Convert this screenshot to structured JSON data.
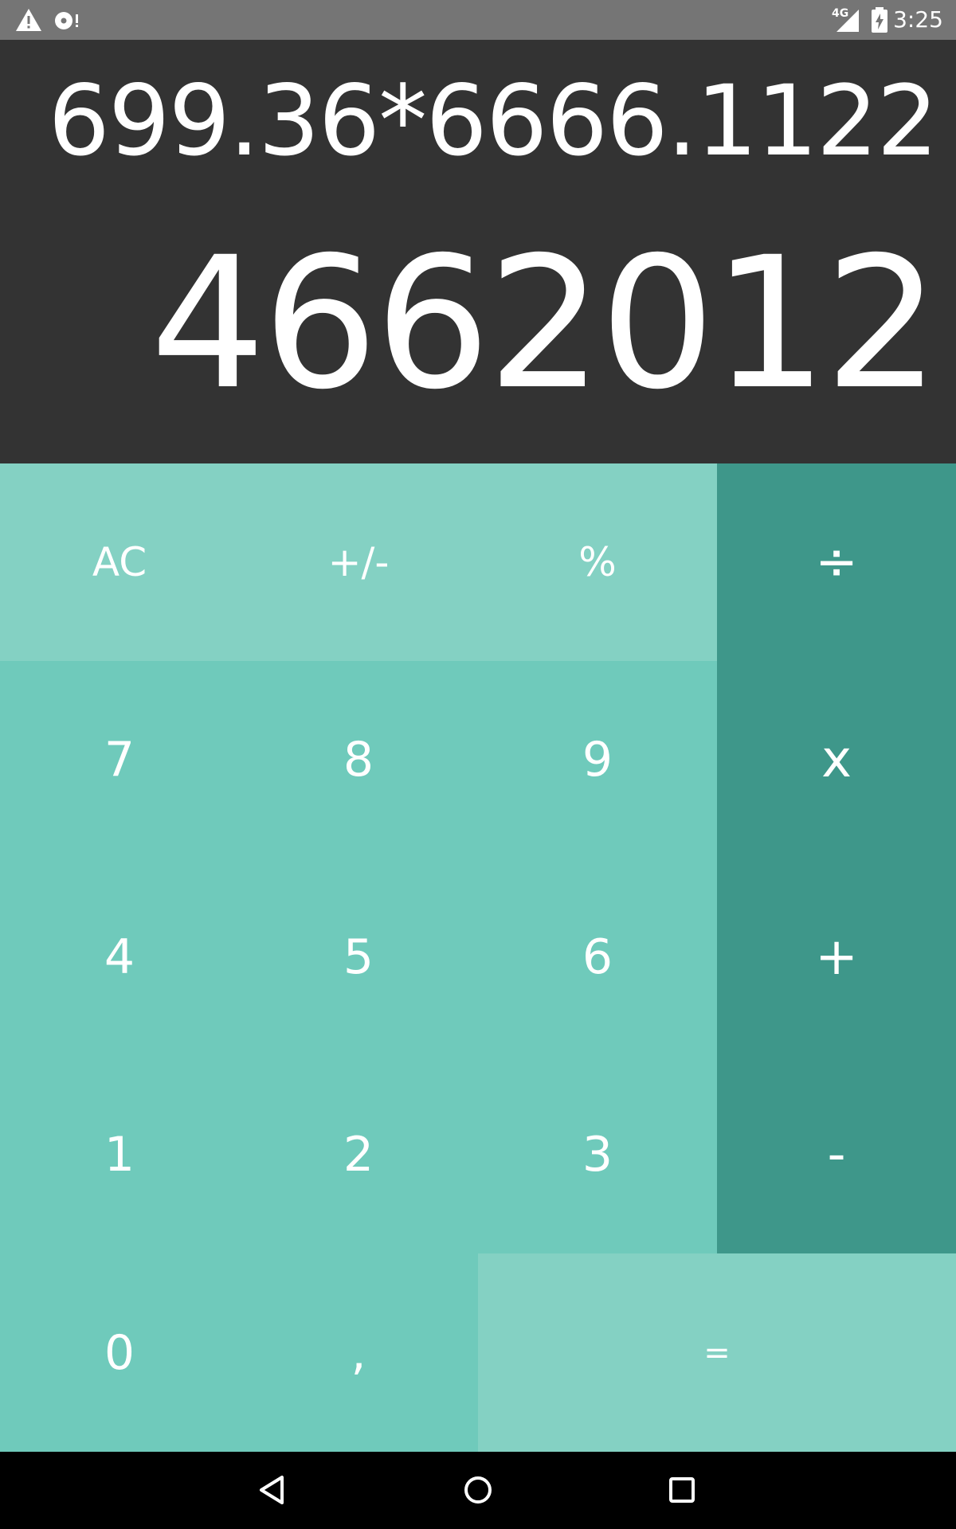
{
  "status_bar": {
    "time": "3:25",
    "network": "4G",
    "icons": [
      "warning-icon",
      "sd-card-alert-icon",
      "signal-icon",
      "battery-charging-icon"
    ]
  },
  "display": {
    "expression": "699.36*6666.1122",
    "result": "4662012"
  },
  "keypad": {
    "ac": "AC",
    "plus_minus": "+/-",
    "percent": "%",
    "divide": "÷",
    "seven": "7",
    "eight": "8",
    "nine": "9",
    "multiply": "x",
    "four": "4",
    "five": "5",
    "six": "6",
    "plus": "+",
    "one": "1",
    "two": "2",
    "three": "3",
    "minus": "-",
    "zero": "0",
    "comma": ",",
    "equals": "="
  },
  "nav_bar": {
    "icons": [
      "back-icon",
      "home-icon",
      "recents-icon"
    ]
  },
  "colors": {
    "status_bar": "#757575",
    "display_bg": "#333333",
    "function_keys": "#84d1c3",
    "number_keys": "#6fcabb",
    "operator_keys": "#3e978a",
    "equals_key": "#84d1c3",
    "text": "#ffffff"
  }
}
